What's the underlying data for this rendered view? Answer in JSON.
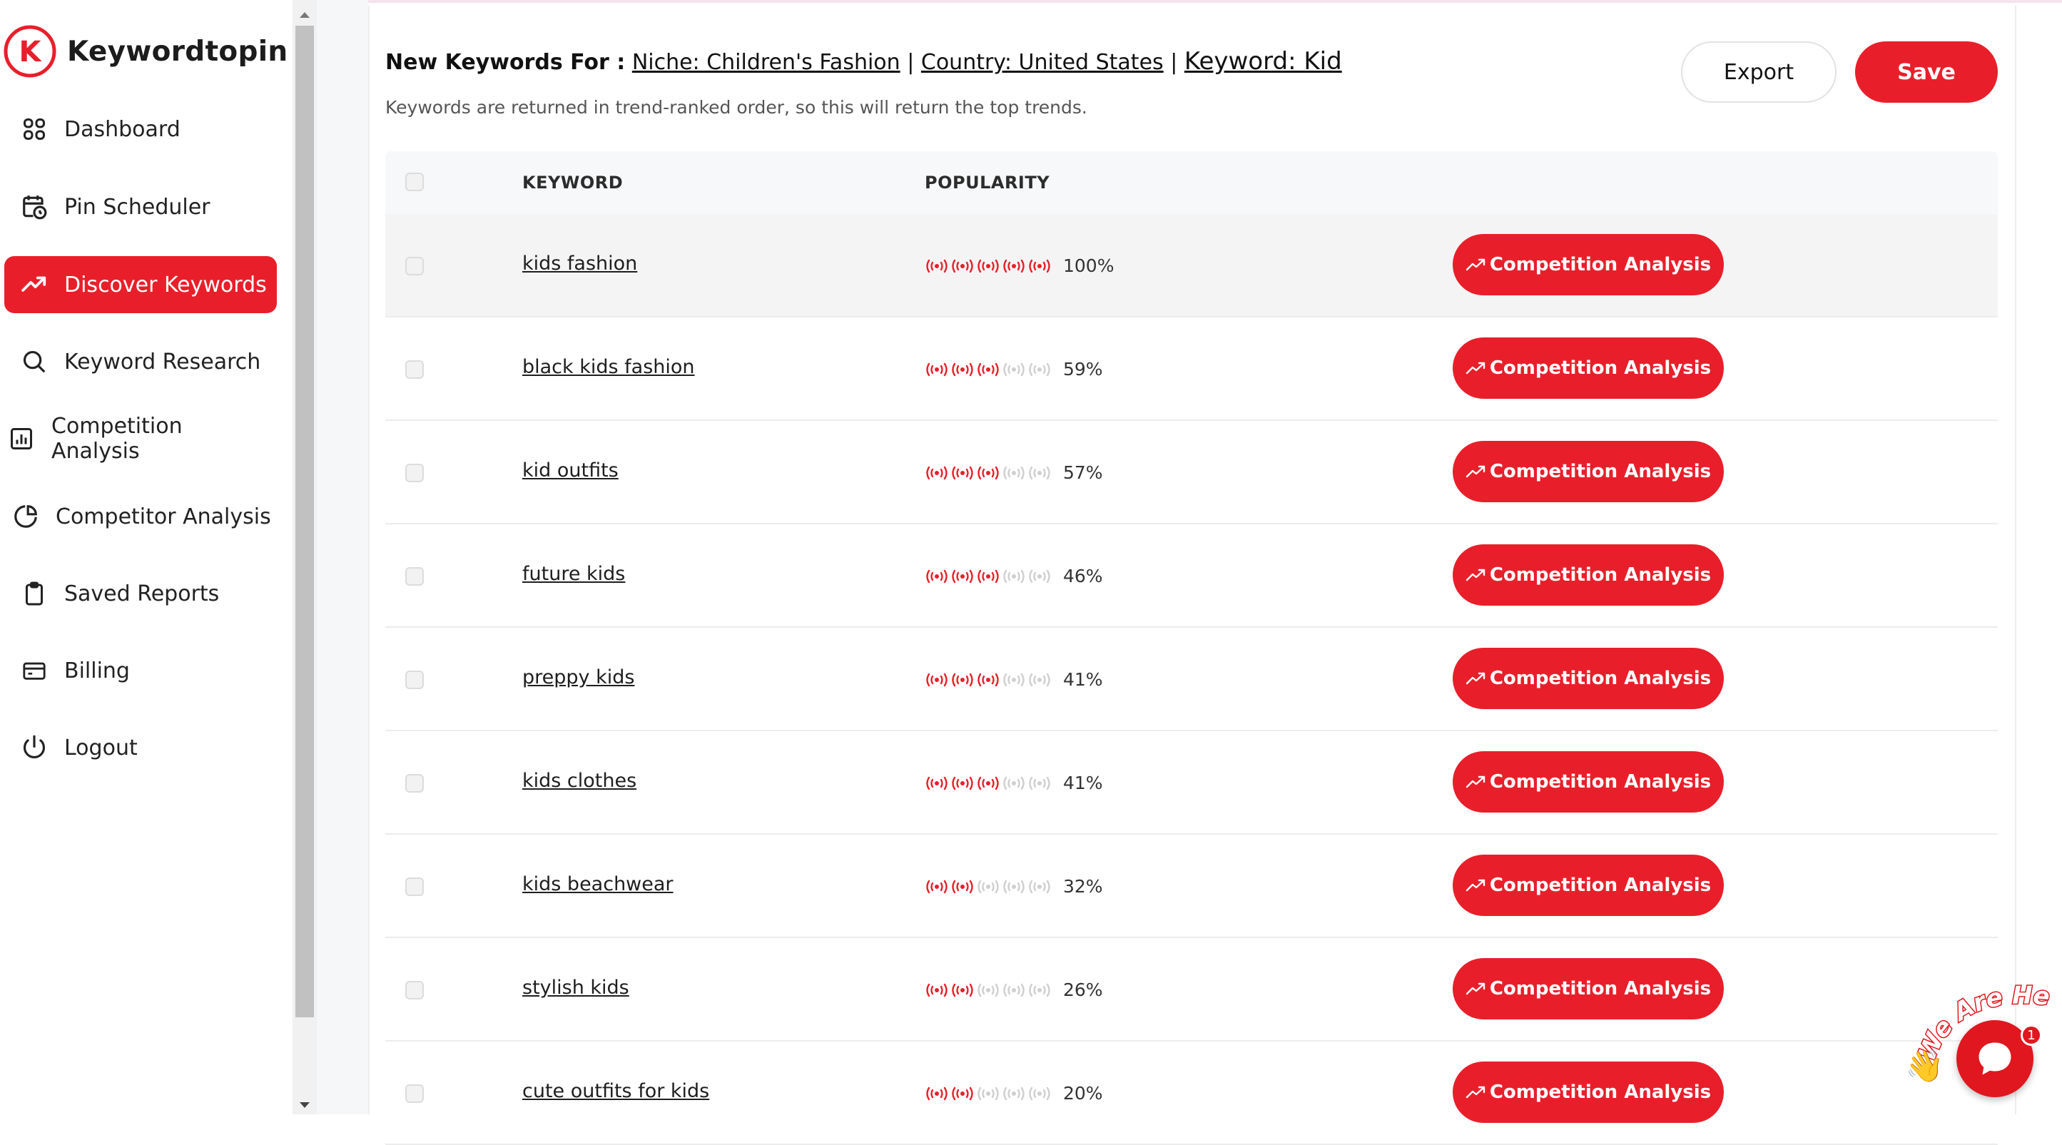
{
  "brand": {
    "name": "Keywordtopin",
    "logo_letter": "K",
    "accent": "#e81f2a"
  },
  "sidebar": {
    "items": [
      {
        "label": "Dashboard",
        "icon": "grid-icon",
        "active": false
      },
      {
        "label": "Pin Scheduler",
        "icon": "calendar-clock-icon",
        "active": false
      },
      {
        "label": "Discover Keywords",
        "icon": "trending-up-icon",
        "active": true
      },
      {
        "label": "Keyword Research",
        "icon": "search-icon",
        "active": false
      },
      {
        "label": "Competition Analysis",
        "icon": "bar-chart-icon",
        "active": false
      },
      {
        "label": "Competitor Analysis",
        "icon": "pie-chart-icon",
        "active": false
      },
      {
        "label": "Saved Reports",
        "icon": "clipboard-icon",
        "active": false
      },
      {
        "label": "Billing",
        "icon": "card-icon",
        "active": false
      },
      {
        "label": "Logout",
        "icon": "power-icon",
        "active": false
      }
    ]
  },
  "header": {
    "label": "New Keywords For :",
    "niche": "Niche: Children's Fashion",
    "country": "Country: United States",
    "keyword": "Keyword: Kid",
    "separator": "|",
    "subtext": "Keywords are returned in trend-ranked order, so this will return the top trends.",
    "export_label": "Export",
    "save_label": "Save"
  },
  "table": {
    "columns": {
      "keyword": "KEYWORD",
      "popularity": "POPULARITY"
    },
    "action_label": "Competition Analysis",
    "rows": [
      {
        "keyword": "kids fashion",
        "popularity": "100%",
        "bars": 5
      },
      {
        "keyword": "black kids fashion",
        "popularity": "59%",
        "bars": 3
      },
      {
        "keyword": "kid outfits",
        "popularity": "57%",
        "bars": 3
      },
      {
        "keyword": "future kids",
        "popularity": "46%",
        "bars": 3
      },
      {
        "keyword": "preppy kids",
        "popularity": "41%",
        "bars": 3
      },
      {
        "keyword": "kids clothes",
        "popularity": "41%",
        "bars": 3
      },
      {
        "keyword": "kids beachwear",
        "popularity": "32%",
        "bars": 2
      },
      {
        "keyword": "stylish kids",
        "popularity": "26%",
        "bars": 2
      },
      {
        "keyword": "cute outfits for kids",
        "popularity": "20%",
        "bars": 2
      }
    ]
  },
  "chat": {
    "tagline": "We Are Here!",
    "badge": "1"
  }
}
